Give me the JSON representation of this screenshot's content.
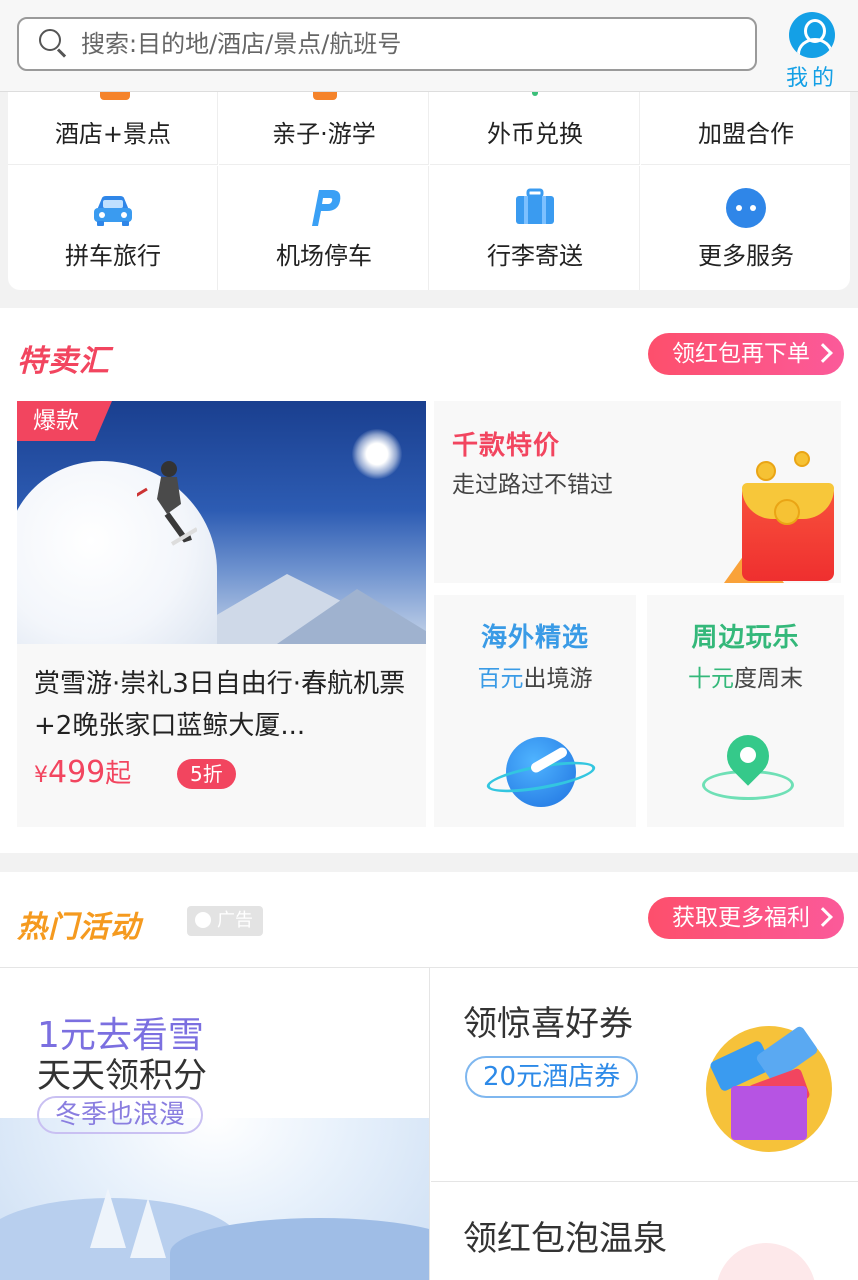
{
  "header": {
    "search_placeholder": "搜索:目的地/酒店/景点/航班号",
    "mine_label": "我的"
  },
  "services": {
    "row1": [
      "酒店+景点",
      "亲子·游学",
      "外币兑换",
      "加盟合作"
    ],
    "row2": [
      "拼车旅行",
      "机场停车",
      "行李寄送",
      "更多服务"
    ],
    "row2_icons": [
      "car-icon",
      "parking-icon",
      "luggage-icon",
      "more-icon"
    ]
  },
  "deals": {
    "title": "特卖汇",
    "action": "领红包再下单",
    "hot": {
      "tag": "爆款",
      "title": "赏雪游·崇礼3日自由行·春航机票+2晚张家口蓝鲸大厦...",
      "price_symbol": "¥",
      "price": "499",
      "price_unit": "起",
      "discount": "5折"
    },
    "card_specials": {
      "title": "千款特价",
      "subtitle": "走过路过不错过"
    },
    "card_overseas": {
      "title": "海外精选",
      "highlight": "百元",
      "rest": "出境游"
    },
    "card_nearby": {
      "title": "周边玩乐",
      "highlight": "十元",
      "rest": "度周末"
    }
  },
  "activities": {
    "title": "热门活动",
    "ad_label": "广告",
    "action": "获取更多福利",
    "left": {
      "line1": "1元去看雪",
      "line2": "天天领积分",
      "pill": "冬季也浪漫"
    },
    "right1": {
      "title": "领惊喜好券",
      "pill": "20元酒店券"
    },
    "right2": {
      "title": "领红包泡温泉"
    }
  },
  "colors": {
    "brand_blue": "#14a0e6",
    "deal_red": "#f2455f",
    "overseas_blue": "#3a9be6",
    "nearby_green": "#34b87a",
    "activity_orange": "#f59a1f"
  }
}
